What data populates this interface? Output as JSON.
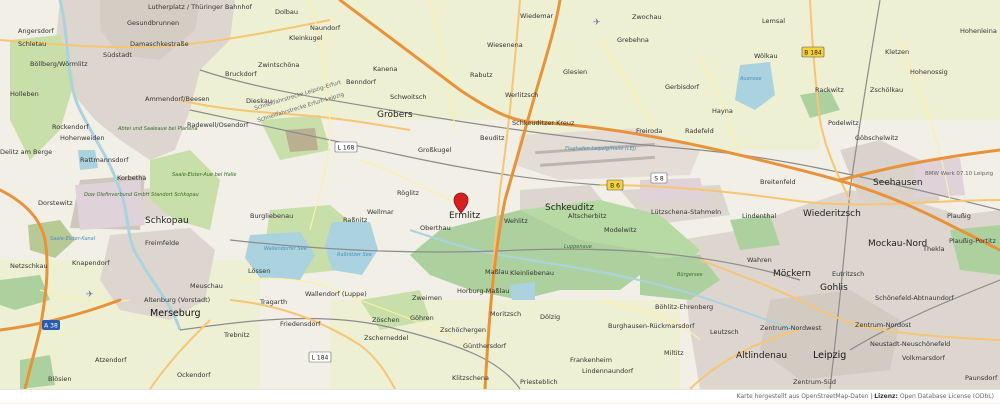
{
  "map": {
    "marker_label": "Ermlitz",
    "places": {
      "lutherplatz": "Lutherplatz / Thüringer Bahnhof",
      "gesundbrunnen": "Gesundbrunnen",
      "angersdorf": "Angersdorf",
      "schletau": "Schletau",
      "suedstadt": "Südstadt",
      "damaschkestrasse": "Damaschkestraße",
      "boellberg": "Böllberg/Wörmlitz",
      "ammendorf": "Ammendorf/Beesen",
      "holleben": "Holleben",
      "rockendorf": "Rockendorf",
      "hohenweiden": "Hohenweiden",
      "rattmannsdorf": "Rattmannsdorf",
      "delitz": "Delitz am Berge",
      "korbetha": "Korbetha",
      "dorstewitz": "Dorstewitz",
      "schkopau": "Schkopau",
      "freimfelde": "Freimfelde",
      "netzschkau": "Netzschkau",
      "knapendorf": "Knapendorf",
      "merseburg": "Merseburg",
      "altenburg": "Altenburg (Vorstadt)",
      "meuschau": "Meuschau",
      "atzendorf": "Atzendorf",
      "trebnitz": "Trebnitz",
      "bloesien": "Blösien",
      "ockendorf": "Ockendorf",
      "dolbau": "Dolbau",
      "naundorf": "Naundorf",
      "kleinkugel": "Kleinkugel",
      "zwintschoena": "Zwintschöna",
      "bruckdorf": "Bruckdorf",
      "dieskau": "Dieskau",
      "radewell": "Radewell/Osendorf",
      "benndorf": "Benndorf",
      "schwoitsch": "Schwoitsch",
      "kanena": "Kanena",
      "groebers": "Gröbers",
      "grosskugel": "Großkugel",
      "beuditz": "Beuditz",
      "roeglitz": "Röglitz",
      "raffnitz": "Raßnitz",
      "burgliebenau": "Burgliebenau",
      "wallendorf": "Wallendorf (Luppe)",
      "loessen": "Lössen",
      "tragarth": "Tragarth",
      "oberthau": "Oberthau",
      "weiman": "Wellmar",
      "friedensdorf": "Friedensdorf",
      "zoeschen": "Zöschen",
      "zscherneddel": "Zscherneddel",
      "goehren": "Göhren",
      "zweimen": "Zweimen",
      "wiedemar": "Wiedemar",
      "wiesenena": "Wiesenena",
      "rabutz": "Rabutz",
      "glesien": "Glesien",
      "werlitzsch": "Werlitzsch",
      "zwochau": "Zwochau",
      "grebehna": "Grebehna",
      "gerbisdorf": "Gerbisdorf",
      "freiroda": "Freiroda",
      "radefeld": "Radefeld",
      "hayna": "Hayna",
      "lemsal": "Lemsal",
      "woelkau": "Wölkau",
      "schkeuditz": "Schkeuditz",
      "wehlitz": "Wehlitz",
      "altscherbitz": "Altscherbitz",
      "modelwitz": "Modelwitz",
      "lutzschena": "Lützschena-Stahmeln",
      "lindenthal": "Lindenthal",
      "breitenfeld": "Breitenfeld",
      "wiederitzsch": "Wiederitzsch",
      "seehausen": "Seehausen",
      "mockau": "Mockau-Nord",
      "thekla": "Thekla",
      "plaussig": "Plaußig-Portitz",
      "eutritzsch": "Eutritzsch",
      "schoenefeld": "Schönefeld-Abtnaundorf",
      "goehlis": "Gohlis",
      "moeckern": "Möckern",
      "wahren": "Wahren",
      "boehlitz": "Böhlitz-Ehrenberg",
      "leutzsch": "Leutzsch",
      "zentrum_nw": "Zentrum-Nordwest",
      "zentrum_no": "Zentrum-Nordost",
      "neustadt": "Neustadt-Neuschönefeld",
      "leipzig": "Leipzig",
      "altlindenau": "Altlindenau",
      "zentrum_sued": "Zentrum-Süd",
      "volkmarsdorf": "Volkmarsdorf",
      "paunsdorf": "Paunsdorf",
      "burghausen": "Burghausen-Rückmarsdorf",
      "miltitz": "Miltitz",
      "frankenheim": "Frankenheim",
      "lindennaundorf": "Lindennaundorf",
      "dolzig": "Dölzig",
      "moritzsch": "Moritzsch",
      "maßlau": "Maßlau",
      "kleinliebenau": "Kleinliebenau",
      "horburg": "Horburg-Maßlau",
      "zschoechergen": "Zschöchergen",
      "guentersdorf": "Günthersdorf",
      "priestablich": "Priesteblich",
      "klitzschena": "Klitzschena",
      "hohenleina": "Hohenleina",
      "kletzen": "Kletzen",
      "hohenossig": "Hohenossig",
      "rackwitz": "Rackwitz",
      "zschoelkau": "Zschölkau",
      "podelwitz": "Podelwitz",
      "goebschelwitz": "Göbschelwitz",
      "pluckaw": "Plaußig",
      "bmw": "BMW Werk 07.10 Leipzig",
      "flughafen": "Flughafen Leipzig/Halle (LEJ)",
      "dow": "Dow Olefinverbund GmbH Standort Schkopau",
      "saale_elster": "Saale-Elster-Aue bei Halle",
      "abtei": "Abtei und Saaleaue bei Planena",
      "auensee": "Auensee",
      "buergersee": "Bürgersee",
      "wallendorfer_see": "Wallendorfer See",
      "rassnitzer_see": "Raßnitzer See",
      "luppenaue": "Luppenaue",
      "schkeuditzer": "Schkeuditzer Kreuz",
      "saale_elster_kanal": "Saale-Elster-Kanal"
    },
    "roads": {
      "l168": "L 168",
      "l184": "L 184",
      "a38": "A 38",
      "b6": "B 6",
      "s8": "S 8",
      "b184": "B 184",
      "schnellfahr_1": "Schnellfahrstrecke Leipzig–Erfurt",
      "schnellfahr_2": "Schnellfahrstrecke Erfurt–Leipzig"
    },
    "colors": {
      "background": "#f2efe6",
      "forest": "#add19e",
      "park": "#c8dfa9",
      "water": "#aad3df",
      "urban": "#dcd6cf",
      "motorway": "#e8923a",
      "primary": "#f7c573",
      "rail": "#8c8c8c",
      "marker": "#d6201f"
    }
  },
  "attribution": {
    "prefix": "Karte hergestellt aus OpenStreetMap-Daten",
    "separator": " | ",
    "license_label": "Lizenz:",
    "license_text": " Open Database License (ODbL)"
  }
}
